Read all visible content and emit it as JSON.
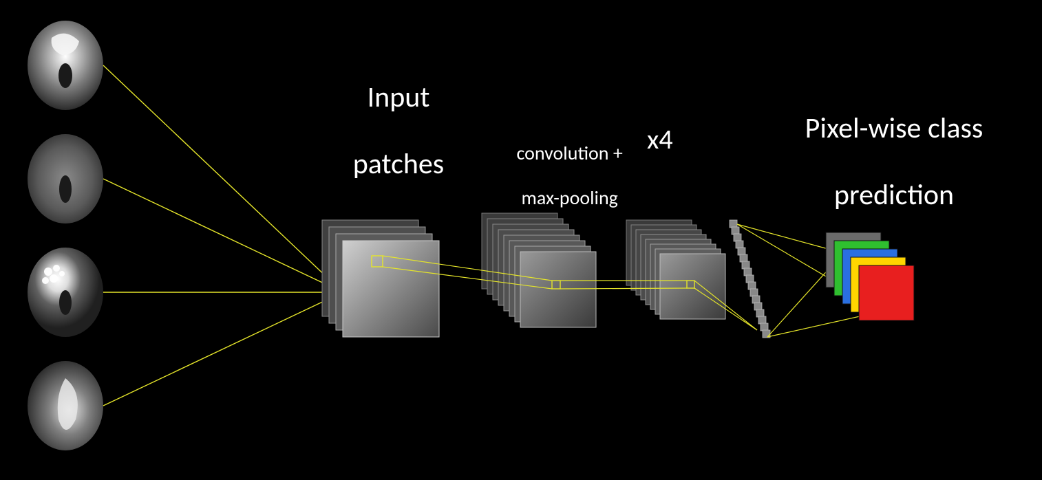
{
  "labels": {
    "input_patches_line1": "Input",
    "input_patches_line2": "patches",
    "conv_line1": "convolution +",
    "conv_line2": "max-pooling",
    "x4": "x4",
    "output_line1": "Pixel-wise class",
    "output_line2": "prediction"
  },
  "diagram": {
    "description": "CNN architecture diagram for pixel-wise classification. Four grayscale brain MRI slices on the left feed into input patches, which pass through repeated convolution + max-pooling blocks (x4), then a flattened vector, producing stacked color pixel-wise class prediction maps on the right.",
    "input_images_count": 4,
    "conv_blocks": 4,
    "output_colors": [
      "#6b6b6b",
      "#2fbf2f",
      "#2a6fe0",
      "#ffd500",
      "#e81f1f"
    ]
  }
}
